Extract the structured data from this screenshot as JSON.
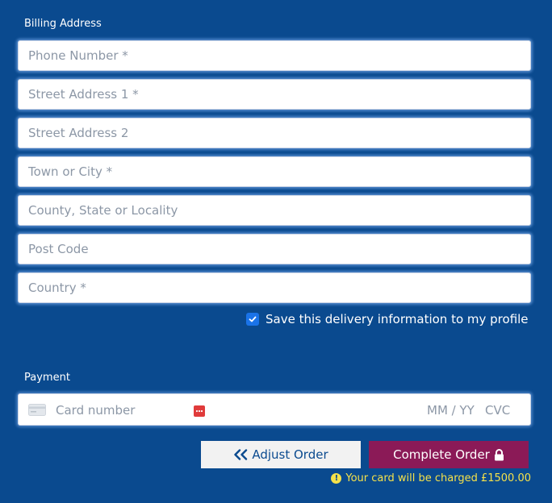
{
  "billing": {
    "section_label": "Billing Address",
    "fields": [
      {
        "placeholder": "Phone Number *",
        "value": ""
      },
      {
        "placeholder": "Street Address 1 *",
        "value": ""
      },
      {
        "placeholder": "Street Address 2",
        "value": ""
      },
      {
        "placeholder": "Town or City *",
        "value": ""
      },
      {
        "placeholder": "County, State or Locality",
        "value": ""
      },
      {
        "placeholder": "Post Code",
        "value": ""
      },
      {
        "placeholder": "Country *",
        "value": ""
      }
    ],
    "save_profile": {
      "label": "Save this delivery information to my profile",
      "checked": true
    }
  },
  "payment": {
    "section_label": "Payment",
    "card_number_placeholder": "Card number",
    "expiry_placeholder": "MM / YY",
    "cvc_placeholder": "CVC",
    "card_brand_icon": "generic-card-icon",
    "card_error_icon": "card-error-icon"
  },
  "actions": {
    "adjust_label": "Adjust Order",
    "adjust_icon": "double-chevron-left-icon",
    "complete_label": "Complete Order",
    "complete_icon": "lock-icon"
  },
  "notice": {
    "text": "Your card will be charged £1500.00",
    "icon": "exclamation-circle-icon"
  },
  "colors": {
    "background": "#0a4a8f",
    "complete_button": "#8b1a57",
    "adjust_button": "#f2f2f2",
    "notice_text": "#f5e14a",
    "checkbox": "#1a73e8"
  }
}
